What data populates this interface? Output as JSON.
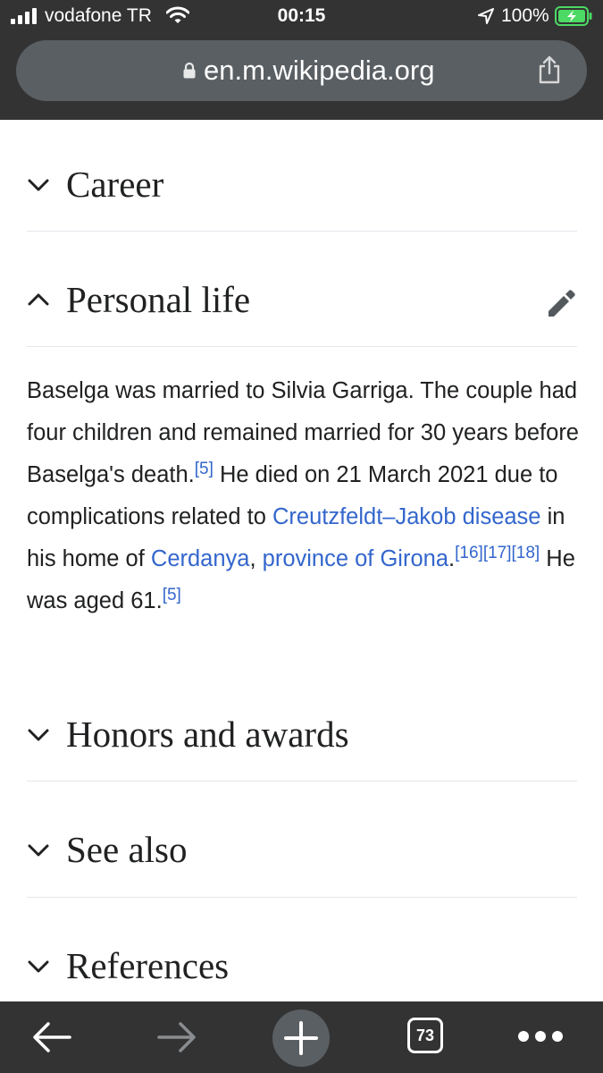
{
  "status_bar": {
    "carrier": "vodafone TR",
    "time": "00:15",
    "battery_percent": "100%",
    "icons": [
      "signal-icon",
      "wifi-icon",
      "location-arrow-icon",
      "battery-charging-icon"
    ]
  },
  "address_bar": {
    "url": "en.m.wikipedia.org",
    "icons": [
      "lock-icon",
      "share-icon"
    ]
  },
  "sections": [
    {
      "title": "Career",
      "expanded": false
    },
    {
      "title": "Personal life",
      "expanded": true
    },
    {
      "title": "Honors and awards",
      "expanded": false
    },
    {
      "title": "See also",
      "expanded": false
    },
    {
      "title": "References",
      "expanded": false
    }
  ],
  "personal_life": {
    "text_1": "Baselga was married to Silvia Garriga. The couple had four children and remained married for 30 years before Baselga's death.",
    "ref_1": "[5]",
    "text_2": " He died on 21 March 2021 due to complications related to ",
    "link_disease": "Creutzfeldt–Jakob disease",
    "text_3": " in his home of ",
    "link_cerdanya": "Cerdanya",
    "text_4": ", ",
    "link_girona": "province of Girona",
    "text_5": ".",
    "ref_2": "[16]",
    "ref_3": "[17]",
    "ref_4": "[18]",
    "text_6": " He was aged 61.",
    "ref_5": "[5]"
  },
  "toolbar": {
    "tab_count": "73",
    "icons": [
      "back-arrow-icon",
      "forward-arrow-icon",
      "plus-icon",
      "tabs-icon",
      "more-icon"
    ]
  },
  "colors": {
    "chrome": "#333333",
    "address_bar": "#5a5f63",
    "link": "#3366cc",
    "text": "#202122",
    "divider": "#e4e6ea",
    "battery": "#4cd964"
  }
}
